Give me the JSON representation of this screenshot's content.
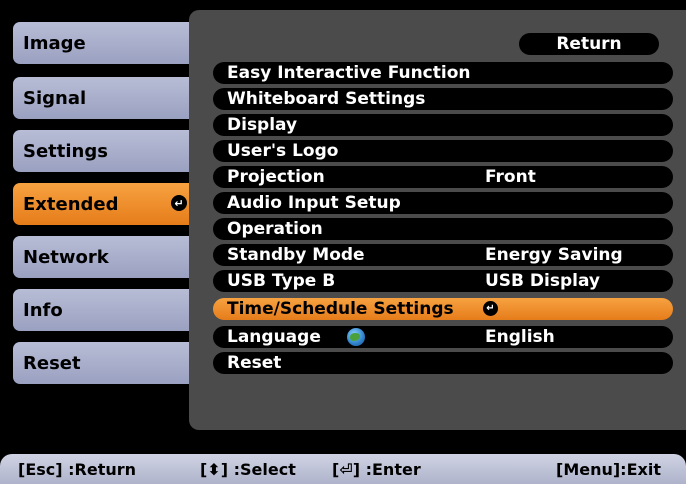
{
  "sidebar": {
    "tabs": [
      {
        "label": "Image"
      },
      {
        "label": "Signal"
      },
      {
        "label": "Settings"
      },
      {
        "label": "Extended",
        "active": true
      },
      {
        "label": "Network"
      },
      {
        "label": "Info"
      },
      {
        "label": "Reset"
      }
    ]
  },
  "panel": {
    "return_label": "Return",
    "rows": [
      {
        "label": "Easy Interactive Function",
        "value": ""
      },
      {
        "label": "Whiteboard Settings",
        "value": ""
      },
      {
        "label": "Display",
        "value": ""
      },
      {
        "label": "User's Logo",
        "value": ""
      },
      {
        "label": "Projection",
        "value": "Front"
      },
      {
        "label": "Audio Input Setup",
        "value": ""
      },
      {
        "label": "Operation",
        "value": ""
      },
      {
        "label": "Standby Mode",
        "value": "Energy Saving"
      },
      {
        "label": "USB Type B",
        "value": "USB Display"
      },
      {
        "label": "Time/Schedule Settings",
        "value": "",
        "selected": true
      },
      {
        "label": "Language",
        "value": "English"
      },
      {
        "label": "Reset",
        "value": ""
      }
    ]
  },
  "footer": {
    "esc": "[Esc] :Return",
    "select": "[⬍] :Select",
    "enter": "[⏎] :Enter",
    "menu": "[Menu]:Exit"
  },
  "colors": {
    "accent": "#f28c28",
    "tab": "#aeb3cb",
    "panel": "#4b4b4b"
  }
}
